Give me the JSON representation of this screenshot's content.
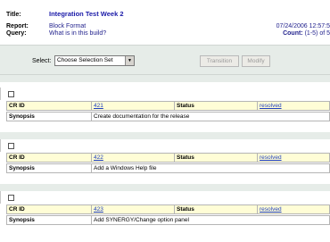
{
  "header": {
    "title_label": "Title:",
    "title_value": "Integration Test Week 2",
    "report_label": "Report:",
    "report_value": "Block Format",
    "query_label": "Query:",
    "query_value": "What is in this build?",
    "datetime": "07/24/2006 12:57:5",
    "count_label": "Count:",
    "count_value": "(1-5) of 5"
  },
  "selectbar": {
    "label": "Select:",
    "selected_option": "Choose Selection Set",
    "transition_label": "Transition",
    "modify_label": "Modify"
  },
  "labels": {
    "crid": "CR ID",
    "status": "Status",
    "synopsis": "Synopsis"
  },
  "records": [
    {
      "id": "421",
      "status": "resolved",
      "synopsis": "Create documentation for the release"
    },
    {
      "id": "422",
      "status": "resolved",
      "synopsis": "Add a Windows Help file"
    },
    {
      "id": "423",
      "status": "resolved",
      "synopsis": "Add SYNERGY/Change option panel"
    }
  ]
}
